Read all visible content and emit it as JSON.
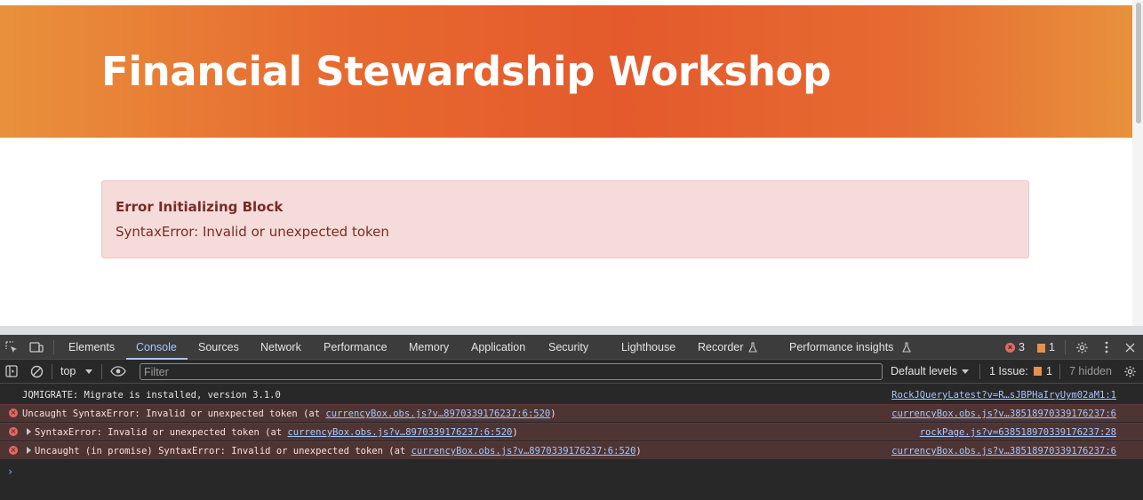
{
  "page": {
    "title": "Financial Stewardship Workshop",
    "alert": {
      "heading": "Error Initializing Block",
      "message": "SyntaxError: Invalid or unexpected token"
    }
  },
  "devtools": {
    "tabs": [
      {
        "label": "Elements"
      },
      {
        "label": "Console",
        "active": true
      },
      {
        "label": "Sources"
      },
      {
        "label": "Network"
      },
      {
        "label": "Performance"
      },
      {
        "label": "Memory"
      },
      {
        "label": "Application"
      },
      {
        "label": "Security"
      },
      {
        "label": "Lighthouse"
      },
      {
        "label": "Recorder"
      },
      {
        "label": "Performance insights"
      }
    ],
    "counts": {
      "errors": "3",
      "warnings": "1"
    },
    "toolbar": {
      "context": "top",
      "filter_placeholder": "Filter",
      "levels": "Default levels",
      "issues_label": "1 Issue:",
      "issues_count": "1",
      "hidden": "7 hidden"
    },
    "messages": [
      {
        "type": "log",
        "text": "JQMIGRATE: Migrate is installed, version 3.1.0",
        "link": "",
        "suffix": "",
        "source": "RockJQueryLatest?v=R…sJBPHaIryUym02aM1:1"
      },
      {
        "type": "error",
        "text": "Uncaught SyntaxError: Invalid or unexpected token (at ",
        "link": "currencyBox.obs.js?v…8970339176237:6:520",
        "suffix": ")",
        "source": "currencyBox.obs.js?v…38518970339176237:6"
      },
      {
        "type": "error",
        "text": "SyntaxError: Invalid or unexpected token (at ",
        "link": "currencyBox.obs.js?v…8970339176237:6:520",
        "suffix": ")",
        "source": "rockPage.js?v=638518970339176237:28"
      },
      {
        "type": "error",
        "text": "Uncaught (in promise) SyntaxError: Invalid or unexpected token (at ",
        "link": "currencyBox.obs.js?v…8970339176237:6:520",
        "suffix": ")",
        "source": "currencyBox.obs.js?v…38518970339176237:6"
      }
    ],
    "prompt": "›"
  },
  "colors": {
    "hero_gradient_start": "#e8913c",
    "hero_gradient_mid": "#e45a2c",
    "alert_bg": "#f5dcda",
    "alert_text": "#7b2a24",
    "devtools_bg": "#282828",
    "accent": "#a8c7fa",
    "error": "#e46962"
  },
  "icons": [
    "inspect-element-icon",
    "device-toolbar-icon",
    "flask-icon",
    "error-icon",
    "issue-flag-icon",
    "settings-gear-icon",
    "more-vert-icon",
    "close-icon",
    "sidebar-toggle-icon",
    "clear-console-icon",
    "chevron-down-icon",
    "eye-icon",
    "expand-triangle-icon",
    "prompt-chevron-icon"
  ]
}
